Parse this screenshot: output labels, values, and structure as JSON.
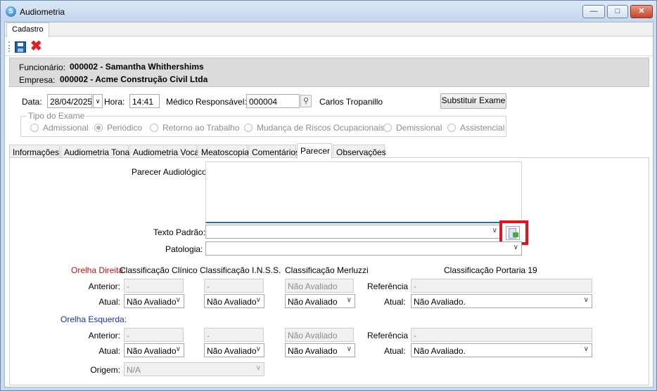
{
  "window": {
    "title": "Audiometria",
    "app_icon": "app-s-icon"
  },
  "outer_tab": "Cadastro",
  "toolbar": {
    "save_icon": "save-disk-icon",
    "cancel_icon": "cancel-x-icon"
  },
  "employee": {
    "label": "Funcionário:",
    "value": "000002 - Samantha Whithershims"
  },
  "company": {
    "label": "Empresa:",
    "value": "000002 - Acme Construção Civil Ltda"
  },
  "exam": {
    "date_label": "Data:",
    "date_value": "28/04/2025",
    "time_label": "Hora:",
    "time_value": "14:41",
    "doctor_label": "Médico Responsável:",
    "doctor_code": "000004",
    "doctor_name": "Carlos Tropanillo",
    "replace_button": "Substituir Exame"
  },
  "exam_type": {
    "title": "Tipo do Exame",
    "options": [
      "Admissional",
      "Periódico",
      "Retorno ao Trabalho",
      "Mudança de Riscos Ocupacionais",
      "Demissional",
      "Assistencial"
    ],
    "selected": "Periódico"
  },
  "tabs": [
    "Informações",
    "Audiometria Tonal",
    "Audiometria Vocal",
    "Meatoscopia",
    "Comentários",
    "Parecer",
    "Observações"
  ],
  "active_tab": "Parecer",
  "parecer": {
    "audiologic_label": "Parecer Audiológico:",
    "audiologic_value": "",
    "default_text_label": "Texto Padrão:",
    "default_text_value": "",
    "pathology_label": "Patologia:",
    "pathology_value": "",
    "apply_icon": "apply-text-document-icon"
  },
  "classification": {
    "right_ear_label": "Orelha Direita:",
    "left_ear_label": "Orelha Esquerda:",
    "col_clinical": "Classificação Clínico",
    "col_inss": "Classificação I.N.S.S.",
    "col_merluzzi": "Classificação Merluzzi",
    "col_portaria": "Classificação Portaria 19",
    "previous_label": "Anterior:",
    "current_label": "Atual:",
    "reference_label": "Referência",
    "current_label_2": "Atual:",
    "right": {
      "previous": {
        "clinical": "-",
        "inss": "-",
        "merluzzi": "Não Avaliado",
        "reference": "-"
      },
      "current": {
        "clinical": "Não Avaliado",
        "inss": "Não Avaliado",
        "merluzzi": "Não Avaliado",
        "portaria": "Não Avaliado."
      }
    },
    "left": {
      "previous": {
        "clinical": "-",
        "inss": "-",
        "merluzzi": "Não Avaliado",
        "reference": "-"
      },
      "current": {
        "clinical": "Não Avaliado",
        "inss": "Não Avaliado",
        "merluzzi": "Não Avaliado",
        "portaria": "Não Avaliado."
      }
    },
    "origin_label": "Origem:",
    "origin_value": "N/A"
  },
  "colors": {
    "highlight": "#e8111b",
    "right_ear": "#cc1111",
    "left_ear": "#1a2fbf",
    "info_band": "#dcdcdc"
  }
}
